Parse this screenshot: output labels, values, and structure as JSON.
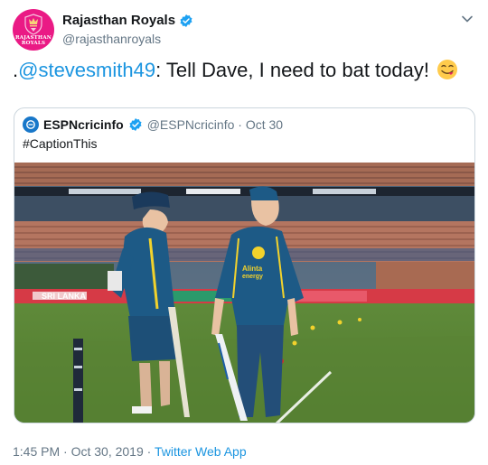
{
  "author": {
    "display_name": "Rajasthan Royals",
    "handle": "@rajasthanroyals",
    "avatar_text": "RAJASTHAN ROYALS",
    "verified": true
  },
  "tweet": {
    "prefix": ".",
    "mention": "@stevesmith49",
    "body": ": Tell Dave, I need to bat today!",
    "emoji": "face-savoring-food"
  },
  "quoted_tweet": {
    "display_name": "ESPNcricinfo",
    "handle_and_date": "@ESPNcricinfo · Oct 30",
    "text": "#CaptionThis",
    "verified": true,
    "photo": {
      "description": "Two cricketers in navy and yellow training kit talking on the field, holding bats, stadium seating behind",
      "left_shirt_text": "Alinta energy",
      "boundary_text": "SRI LANKA"
    }
  },
  "footer": {
    "time_date": "1:45 PM · Oct 30, 2019 · ",
    "source": "Twitter Web App"
  },
  "colors": {
    "brand_pink": "#ea1a85",
    "link_blue": "#1b95e0",
    "verified_blue": "#1da1f2",
    "muted_gray": "#657786",
    "border": "#ccd6dd"
  }
}
